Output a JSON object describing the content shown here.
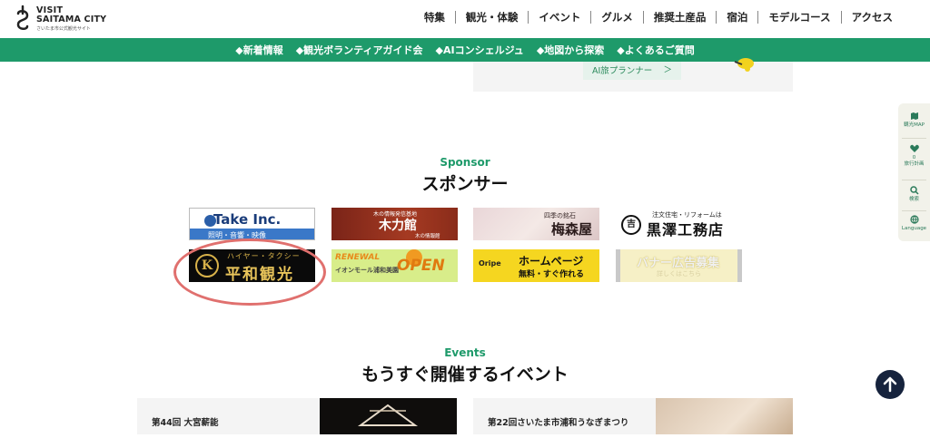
{
  "header": {
    "logo": {
      "line1": "VISIT",
      "line2": "SAITAMA CITY",
      "tagline": "さいたま市公式観光サイト"
    },
    "nav": [
      "特集",
      "観光・体験",
      "イベント",
      "グルメ",
      "推奨土産品",
      "宿泊",
      "モデルコース",
      "アクセス"
    ]
  },
  "subnav": [
    "◆新着情報",
    "◆観光ボランティアガイド会",
    "◆AIコンシェルジュ",
    "◆地図から探索",
    "◆よくあるご質問"
  ],
  "ai_card": {
    "button_label": "AI旅プランナー",
    "chevron": "＞"
  },
  "sponsor": {
    "title_en": "Sponsor",
    "title_ja": "スポンサー",
    "banners": {
      "take": {
        "main": "Take Inc.",
        "sub": "照明・音響・映像"
      },
      "kiryoku": {
        "sub": "木の情報発信基地",
        "main": "木力館",
        "foot": "木の情報館"
      },
      "umeya": {
        "sub": "四季の銘石",
        "main": "梅森屋"
      },
      "kurosawa": {
        "sub": "注文住宅・リフォームは",
        "main": "黒澤工務店",
        "logo": "吉"
      },
      "heiwa": {
        "emblem": "K",
        "sub": "ハイヤー・タクシー",
        "main": "平和観光"
      },
      "aeon": {
        "renewal": "RENEWAL",
        "sub": "イオンモール浦和美園",
        "open": "OPEN"
      },
      "oripe": {
        "logo": "Oripe",
        "main": "ホームページ",
        "sub": "無料・すぐ作れる"
      },
      "ad": {
        "main": "バナー広告募集",
        "sub": "詳しくはこちら"
      }
    }
  },
  "events": {
    "title_en": "Events",
    "title_ja": "もうすぐ開催するイベント",
    "cards": [
      {
        "title": "第44回 大宮薪能"
      },
      {
        "title": "第22回さいたま市浦和うなぎまつり"
      }
    ]
  },
  "sidenav": [
    {
      "label": "観光MAP"
    },
    {
      "label": "0\n旅行計画"
    },
    {
      "label": "検索"
    },
    {
      "label": "Language"
    }
  ],
  "colors": {
    "brand_green": "#1e9a6a",
    "highlight": "#e0706e",
    "to_top": "#16233d"
  }
}
